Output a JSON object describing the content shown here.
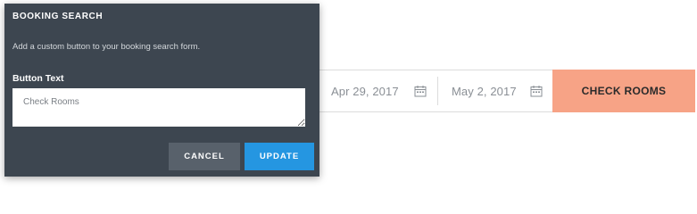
{
  "panel": {
    "title": "BOOKING SEARCH",
    "description": "Add a custom button to your booking search form.",
    "field_label": "Button Text",
    "field_value": "Check Rooms",
    "cancel_label": "CANCEL",
    "update_label": "UPDATE",
    "background_color": "#3d4650",
    "update_color": "#2596e1",
    "cancel_color": "#58616b"
  },
  "search_form": {
    "checkin_date": "Apr 29, 2017",
    "checkout_date": "May 2, 2017",
    "date_icon": "calendar-icon",
    "button_label": "CHECK ROOMS",
    "button_color": "#f7a386"
  }
}
